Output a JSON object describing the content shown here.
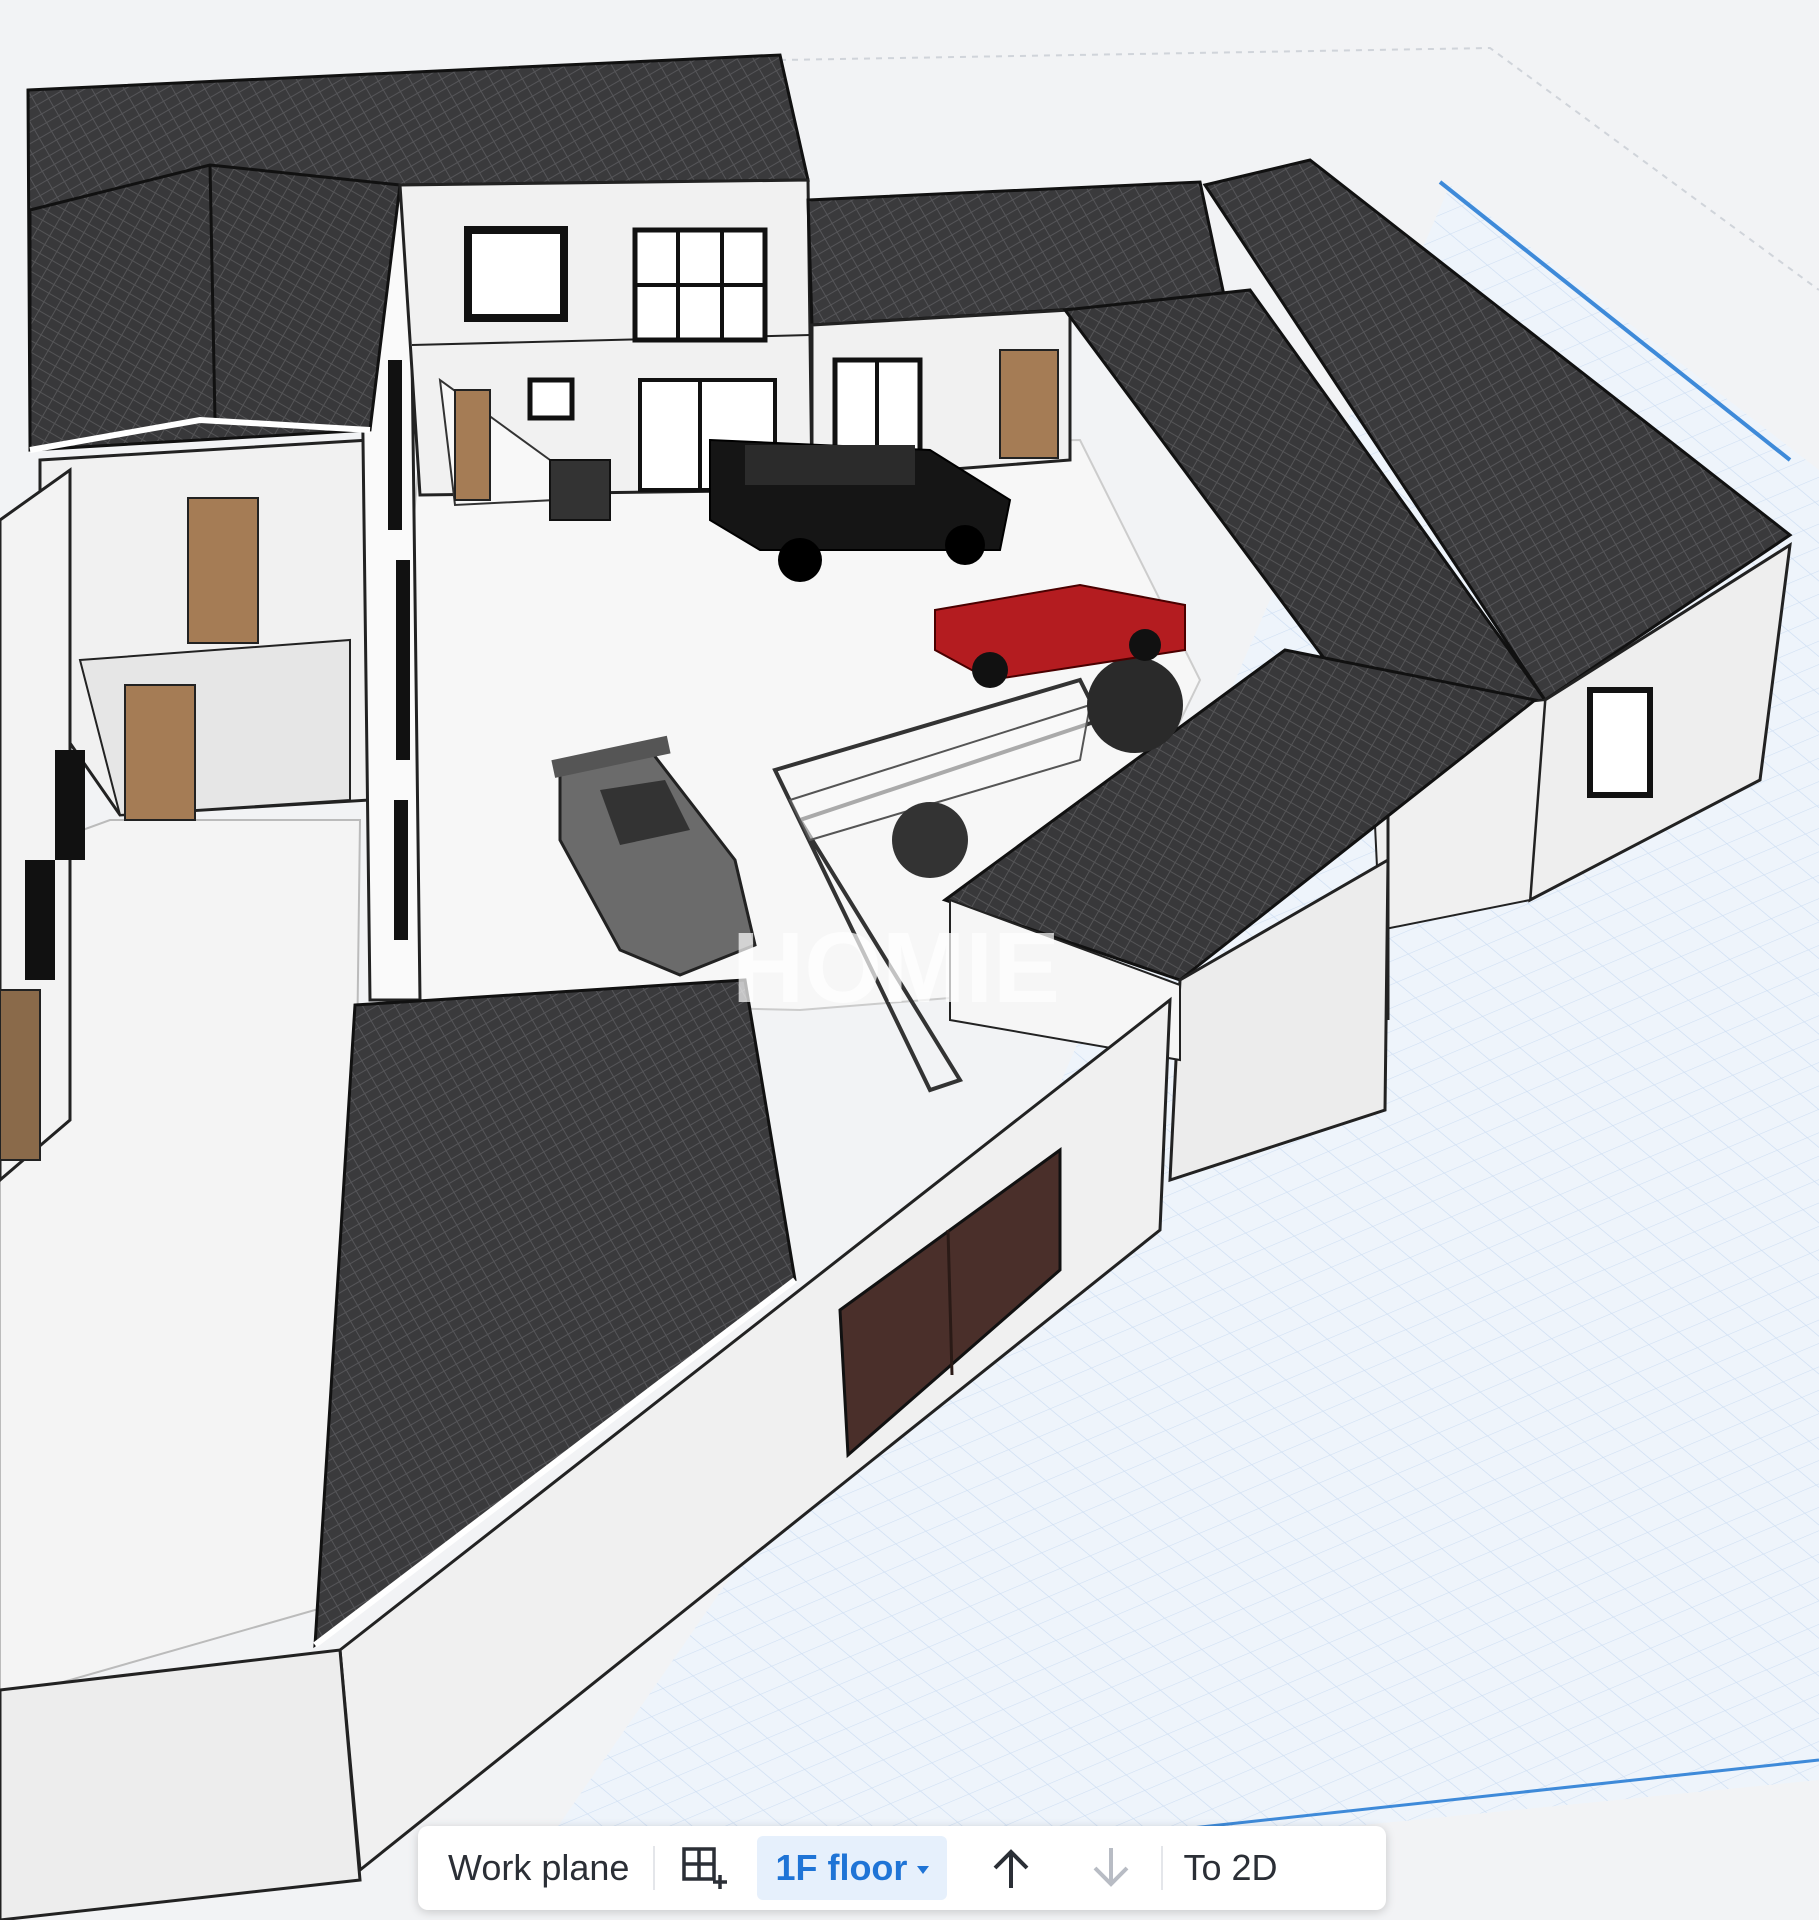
{
  "toolbar": {
    "work_plane_label": "Work plane",
    "floor_selector_value": "1F floor",
    "to_2d_label": "To 2D",
    "icons": [
      "add-floor-icon",
      "floor-up-icon",
      "floor-down-icon"
    ]
  },
  "watermark": "HOMIE",
  "colors": {
    "accent": "#1f74d6",
    "accent_bg": "#e6f0fc",
    "roof": "#3a3a3c",
    "wall": "#f2f2f2",
    "floor": "#f7f7f7",
    "grid": "#d7e6f7",
    "grid_border": "#3e8ad9"
  }
}
